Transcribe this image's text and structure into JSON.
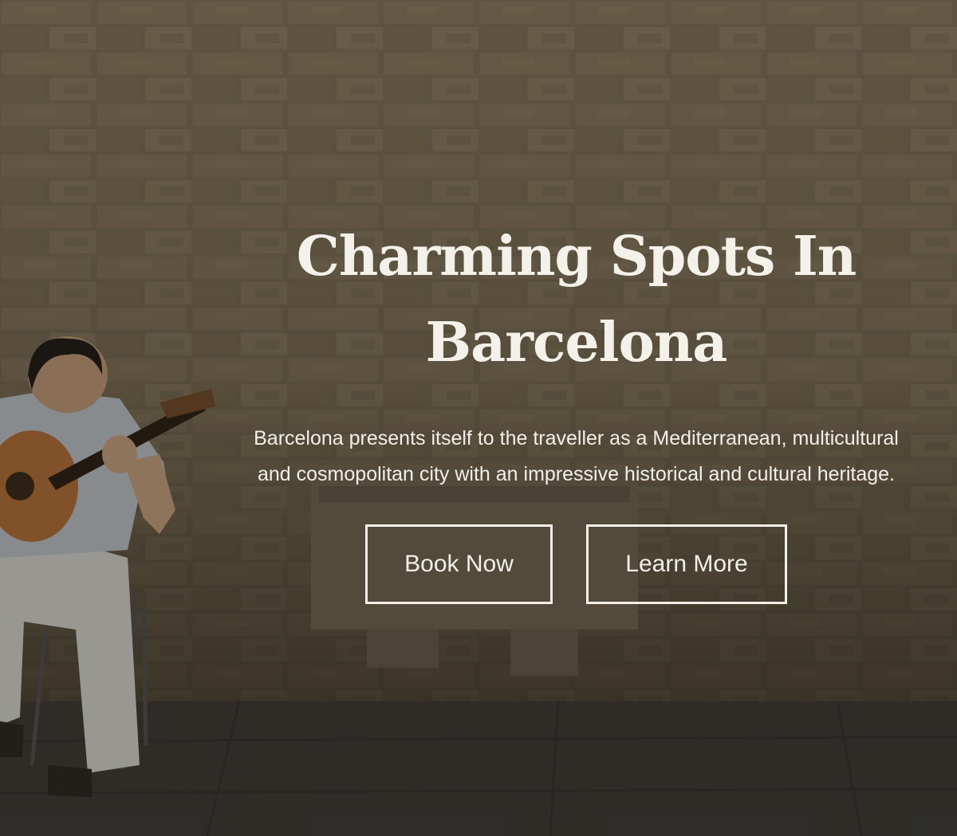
{
  "hero": {
    "title": "Charming Spots In Barcelona",
    "subtitle": "Barcelona presents itself to the traveller as a Mediterranean, multicultural and cosmopolitan city with an impressive historical and cultural heritage.",
    "buttons": {
      "book_label": "Book Now",
      "learn_label": "Learn More"
    }
  },
  "colors": {
    "text": "#f2efe8",
    "wall": "#8a7a60",
    "ground": "#3e3c38"
  }
}
